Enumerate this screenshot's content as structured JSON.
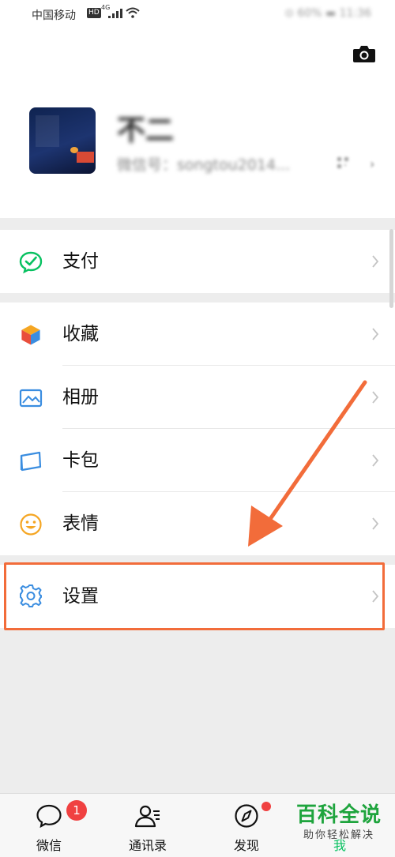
{
  "status_bar": {
    "carrier": "中国移动",
    "hd_badge": "HD",
    "network_type": "4G",
    "right_text": "⊙ 60% ▬ 11:36"
  },
  "profile": {
    "nickname": "不二",
    "wechat_id": "微信号：songtou2014...",
    "chevron": "›"
  },
  "menu": {
    "pay": {
      "label": "支付",
      "icon": "wechat-pay-icon"
    },
    "items": [
      {
        "label": "收藏",
        "icon": "favorites-cube-icon"
      },
      {
        "label": "相册",
        "icon": "album-picture-icon"
      },
      {
        "label": "卡包",
        "icon": "card-wallet-icon"
      },
      {
        "label": "表情",
        "icon": "sticker-smile-icon"
      }
    ],
    "settings": {
      "label": "设置",
      "icon": "gear-icon"
    }
  },
  "tab_bar": {
    "tabs": [
      {
        "label": "微信",
        "badge": "1"
      },
      {
        "label": "通讯录"
      },
      {
        "label": "发现"
      },
      {
        "label": "我"
      }
    ]
  },
  "watermark": {
    "title": "百科全说",
    "subtitle": "助你轻松解决"
  },
  "colors": {
    "accent_green": "#07c160",
    "highlight_orange": "#f26c3a",
    "badge_red": "#f04141",
    "watermark_green": "#1ea43d"
  }
}
